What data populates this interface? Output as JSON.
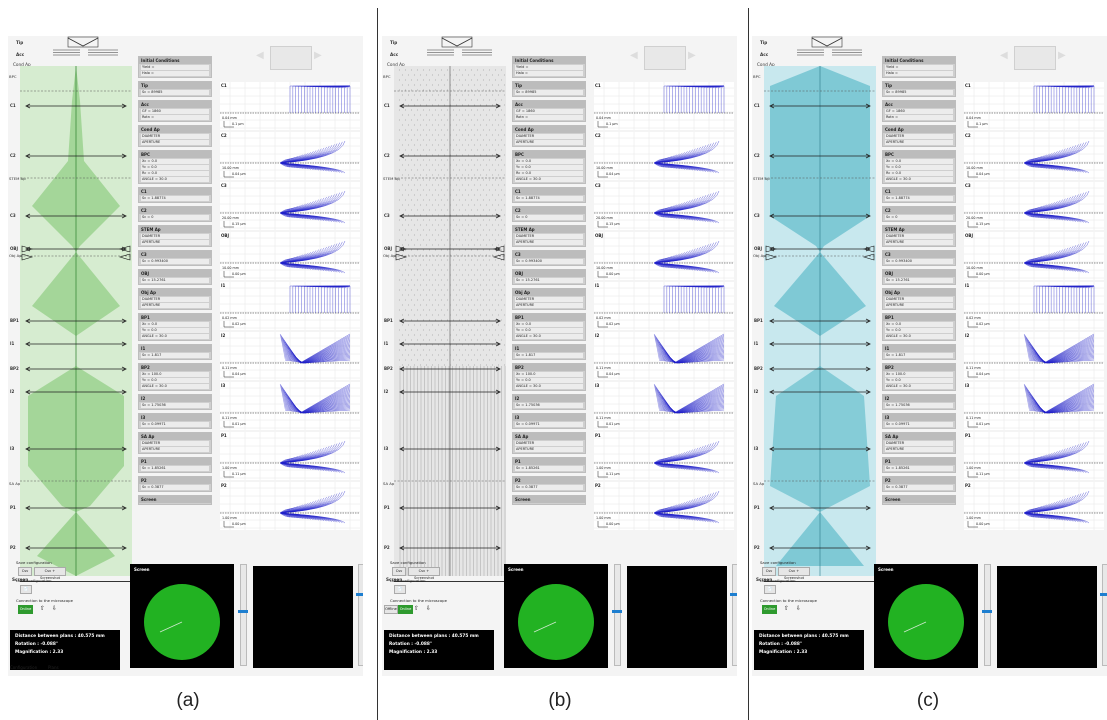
{
  "captions": [
    "(a)",
    "(b)",
    "(c)"
  ],
  "labels": {
    "tip": "Tip",
    "acc": "Acc",
    "cond_ap": "Cond Ap",
    "bpc": "BPC",
    "stem_ap": "STEM Ap",
    "obj": "OBJ",
    "obj_ap": "Obj Ap",
    "sa_ap": "SA Ap",
    "screen": "Screen"
  },
  "lens_names": [
    "C1",
    "C2",
    "C3",
    "OBJ",
    "BP1",
    "I1",
    "BP2",
    "I2",
    "I3",
    "P1",
    "P2"
  ],
  "param_blocks": [
    {
      "title": "Initial Conditions",
      "rows": [
        "Yield =",
        "Halo ="
      ]
    },
    {
      "title": "Tip",
      "rows": [
        "Sc = 89985"
      ]
    },
    {
      "title": "Acc",
      "rows": [
        "GF = 1860",
        "Rotn ="
      ]
    },
    {
      "title": "Cond Ap",
      "rows": [
        "DIAMETER",
        "APERTURE"
      ]
    },
    {
      "title": "BPC",
      "rows": [
        "Xc = 0.0",
        "Yc = 0.0",
        "Rc = 0.0",
        "ANGLE = 30.0"
      ]
    },
    {
      "title": "C1",
      "rows": [
        "Sc = 1.88774"
      ]
    },
    {
      "title": "C2",
      "rows": [
        "Sc = 0"
      ]
    },
    {
      "title": "STEM Ap",
      "rows": [
        "DIAMETER",
        "APERTURE"
      ]
    },
    {
      "title": "C3",
      "rows": [
        "Sc = 0.993400"
      ]
    },
    {
      "title": "OBJ",
      "rows": [
        "Sc = 15.2761"
      ]
    },
    {
      "title": "Obj Ap",
      "rows": [
        "DIAMETER",
        "APERTURE"
      ]
    },
    {
      "title": "BP1",
      "rows": [
        "Xc = 0.0",
        "Yc = 0.0",
        "ANGLE = 30.0"
      ]
    },
    {
      "title": "I1",
      "rows": [
        "Sc = 1.817"
      ]
    },
    {
      "title": "BP2",
      "rows": [
        "Xc = 100.0",
        "Yc = 0.0",
        "ANGLE = 30.0"
      ]
    },
    {
      "title": "I2",
      "rows": [
        "Sc = 1.75036"
      ]
    },
    {
      "title": "I3",
      "rows": [
        "Sc = 0.09971"
      ]
    },
    {
      "title": "SA Ap",
      "rows": [
        "DIAMETER",
        "APERTURE"
      ]
    },
    {
      "title": "P1",
      "rows": [
        "Sc = 1.85261"
      ]
    },
    {
      "title": "P2",
      "rows": [
        "Sc = 0.3877"
      ]
    },
    {
      "title": "Screen",
      "rows": []
    }
  ],
  "plots": [
    {
      "name": "C1",
      "scale_mm": "0.04 mm",
      "scale_um": "0.1 µm"
    },
    {
      "name": "C2",
      "scale_mm": "10.00 mm",
      "scale_um": "0.04 µm"
    },
    {
      "name": "C3",
      "scale_mm": "20.00 mm",
      "scale_um": "0.15 µm"
    },
    {
      "name": "OBJ",
      "scale_mm": "10.00 mm",
      "scale_um": "0.00 µm"
    },
    {
      "name": "I1",
      "scale_mm": "0.02 mm",
      "scale_um": "0.02 µm"
    },
    {
      "name": "I2",
      "scale_mm": "0.11 mm",
      "scale_um": "0.04 µm"
    },
    {
      "name": "I3",
      "scale_mm": "0.11 mm",
      "scale_um": "0.01 µm"
    },
    {
      "name": "P1",
      "scale_mm": "1.00 mm",
      "scale_um": "0.11 µm"
    },
    {
      "name": "P2",
      "scale_mm": "1.00 mm",
      "scale_um": "0.00 µm"
    }
  ],
  "controls": {
    "save_configuration": "Save configuration",
    "csv": "Csv",
    "csv_screenshot": "Csv + Screenshot",
    "load_configuration": "Load configuration",
    "connection": "Connection to the microscope",
    "online": "Online",
    "offline": "Offline"
  },
  "screen": {
    "title": "Screen"
  },
  "info": {
    "distance": "Distance between plans : 40.575 mm",
    "rotation": "Rotation : -0.088°",
    "magnification": "Magnification : 2.33"
  },
  "nav": {
    "configuration": "Configuration",
    "plans": "Plans"
  },
  "colors": {
    "green_beam": "#7cc46c",
    "green_bg": "#d6ecd0",
    "cyan_beam": "#4fb4c4",
    "cyan_bg": "#c8e8ee",
    "gray_bg": "#e6e6e6",
    "blue_lines": "#2020c8",
    "screen_green": "#22b222"
  }
}
